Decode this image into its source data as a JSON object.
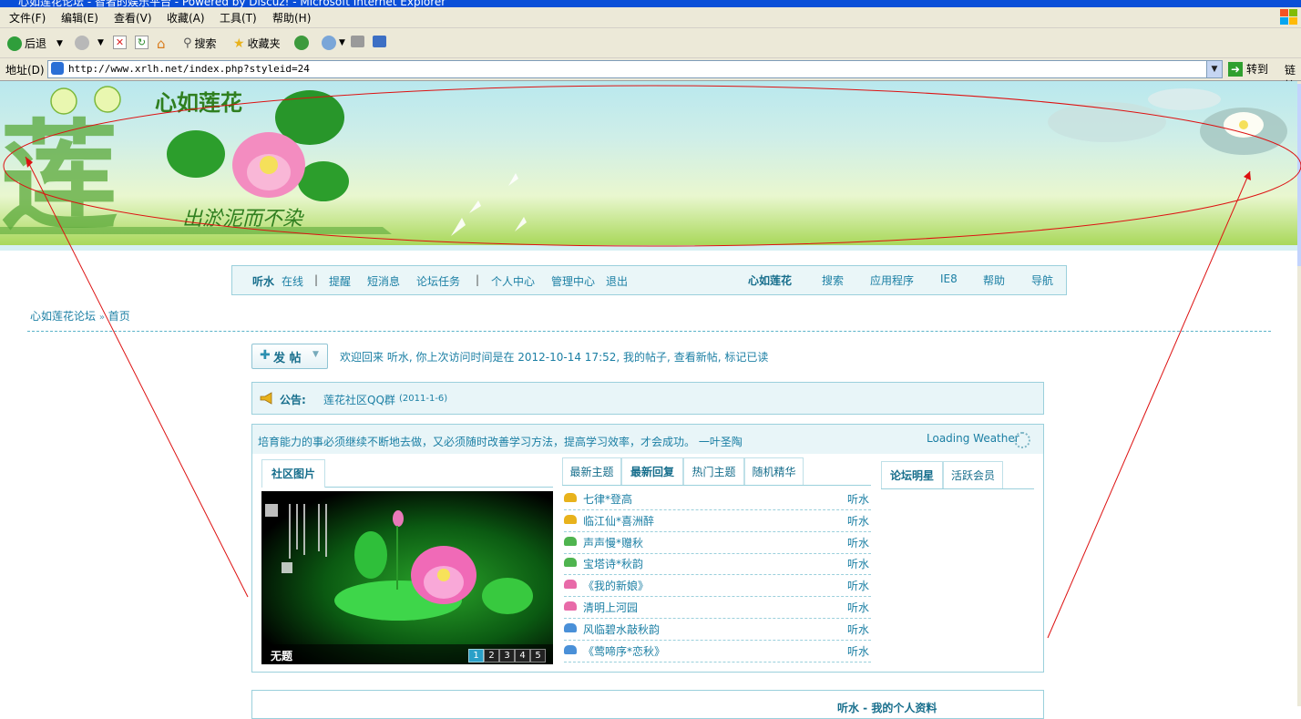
{
  "window": {
    "title": "心如莲花论坛 - 智者的娱乐平台 - Powered by Discuz! - Microsoft Internet Explorer"
  },
  "menu": [
    "文件(F)",
    "编辑(E)",
    "查看(V)",
    "收藏(A)",
    "工具(T)",
    "帮助(H)"
  ],
  "toolbar": {
    "back": "后退",
    "search": "搜索",
    "favorites": "收藏夹"
  },
  "address": {
    "label": "地址(D)",
    "url": "http://www.xrlh.net/index.php?styleid=24",
    "go": "转到",
    "links": "链接"
  },
  "banner": {
    "logo_text": "心如莲花",
    "big_char": "莲",
    "slogan": "出淤泥而不染"
  },
  "nav": {
    "user": "听水",
    "online": "在线",
    "remind": "提醒",
    "messages": "短消息",
    "tasks": "论坛任务",
    "profile": "个人中心",
    "admin": "管理中心",
    "logout": "退出",
    "forum_name": "心如莲花",
    "search": "搜索",
    "apps": "应用程序",
    "ie8": "IE8",
    "help": "帮助",
    "guide": "导航"
  },
  "breadcrumb": {
    "home": "心如莲花论坛",
    "sep": "»",
    "current": "首页"
  },
  "post_button": {
    "label": "发 帖"
  },
  "welcome": {
    "text": "欢迎回来  听水, 你上次访问时间是在  2012-10-14 17:52, ",
    "my_posts": "我的帖子",
    "new_posts": "查看新帖",
    "mark_read": "标记已读"
  },
  "notice": {
    "title": "公告:",
    "link": "莲花社区QQ群",
    "date": "(2011-1-6)"
  },
  "quote": "培育能力的事必须继续不断地去做，又必须随时改善学习方法，提高学习效率，才会成功。  一叶圣陶",
  "weather": "Loading Weather",
  "tabs_left": [
    "社区图片"
  ],
  "tabs_mid": [
    "最新主题",
    "最新回复",
    "热门主题",
    "随机精华"
  ],
  "tabs_right": [
    "论坛明星",
    "活跃会员"
  ],
  "photo": {
    "caption": "无题",
    "pages": [
      "1",
      "2",
      "3",
      "4",
      "5"
    ]
  },
  "threads": [
    {
      "title": "七律*登高",
      "author": "听水",
      "color": "#e8b21c"
    },
    {
      "title": "临江仙*喜洲醉",
      "author": "听水",
      "color": "#e8b21c"
    },
    {
      "title": "声声慢*赠秋",
      "author": "听水",
      "color": "#4fb44f"
    },
    {
      "title": "宝塔诗*秋韵",
      "author": "听水",
      "color": "#4fb44f"
    },
    {
      "title": "《我的新娘》",
      "author": "听水",
      "color": "#e86aa8"
    },
    {
      "title": "清明上河园",
      "author": "听水",
      "color": "#e86aa8"
    },
    {
      "title": "风临碧水敲秋韵",
      "author": "听水",
      "color": "#4a90d8"
    },
    {
      "title": "《莺啼序*恋秋》",
      "author": "听水",
      "color": "#4a90d8"
    }
  ],
  "next_box": {
    "text": "听水 - 我的个人资料"
  }
}
